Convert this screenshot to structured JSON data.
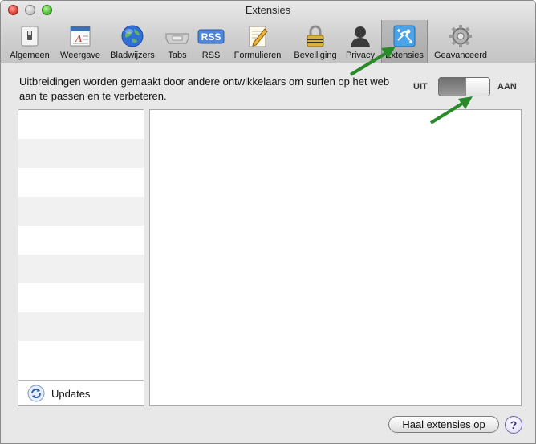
{
  "window": {
    "title": "Extensies"
  },
  "toolbar": {
    "items": [
      {
        "label": "Algemeen",
        "icon": "switch-icon"
      },
      {
        "label": "Weergave",
        "icon": "font-icon"
      },
      {
        "label": "Bladwijzers",
        "icon": "globe-icon"
      },
      {
        "label": "Tabs",
        "icon": "tabs-icon"
      },
      {
        "label": "RSS",
        "icon": "rss-icon",
        "badge": "RSS"
      },
      {
        "label": "Formulieren",
        "icon": "pencil-paper-icon"
      },
      {
        "label": "Beveiliging",
        "icon": "lock-icon"
      },
      {
        "label": "Privacy",
        "icon": "person-silhouette-icon"
      },
      {
        "label": "Extensies",
        "icon": "puzzle-icon",
        "selected": true
      },
      {
        "label": "Geavanceerd",
        "icon": "gear-icon"
      }
    ]
  },
  "description": "Uitbreidingen worden gemaakt door andere ontwikkelaars om surfen op het web aan te passen en te verbeteren.",
  "toggle": {
    "off_label": "UIT",
    "on_label": "AAN",
    "state": "off"
  },
  "list": {
    "footer_label": "Updates"
  },
  "buttons": {
    "get_extensions": "Haal extensies op",
    "help": "?"
  },
  "colors": {
    "annotation_arrow": "#2a8a2a"
  }
}
